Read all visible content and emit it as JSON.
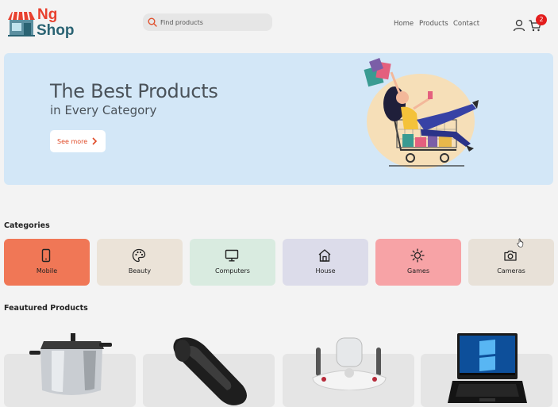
{
  "header": {
    "logo_line1": "Ng",
    "logo_line2": "Shop",
    "search_placeholder": "Find products",
    "nav": [
      "Home",
      "Products",
      "Contact"
    ],
    "cart_count": "2"
  },
  "hero": {
    "title": "The Best Products",
    "subtitle": "in Every Category",
    "cta_label": "See more"
  },
  "categories": {
    "title": "Categories",
    "items": [
      {
        "label": "Mobile",
        "icon": "mobile-icon",
        "color": "#f07756"
      },
      {
        "label": "Beauty",
        "icon": "palette-icon",
        "color": "#ebe3d8"
      },
      {
        "label": "Computers",
        "icon": "monitor-icon",
        "color": "#d9ebe0"
      },
      {
        "label": "House",
        "icon": "house-icon",
        "color": "#dcdcea"
      },
      {
        "label": "Games",
        "icon": "sun-icon",
        "color": "#f7a3a6"
      },
      {
        "label": "Cameras",
        "icon": "camera-icon",
        "color": "#e8e1d8"
      }
    ]
  },
  "featured": {
    "title": "Feautured Products",
    "products": [
      {
        "image": "pressure-cooker"
      },
      {
        "image": "handheld-vacuum"
      },
      {
        "image": "kitchen-appliance"
      },
      {
        "image": "laptop"
      }
    ]
  },
  "colors": {
    "brand_red": "#e8412f",
    "brand_teal": "#2a6373",
    "hero_bg": "#d3e7f7",
    "badge": "#e31d1d"
  }
}
